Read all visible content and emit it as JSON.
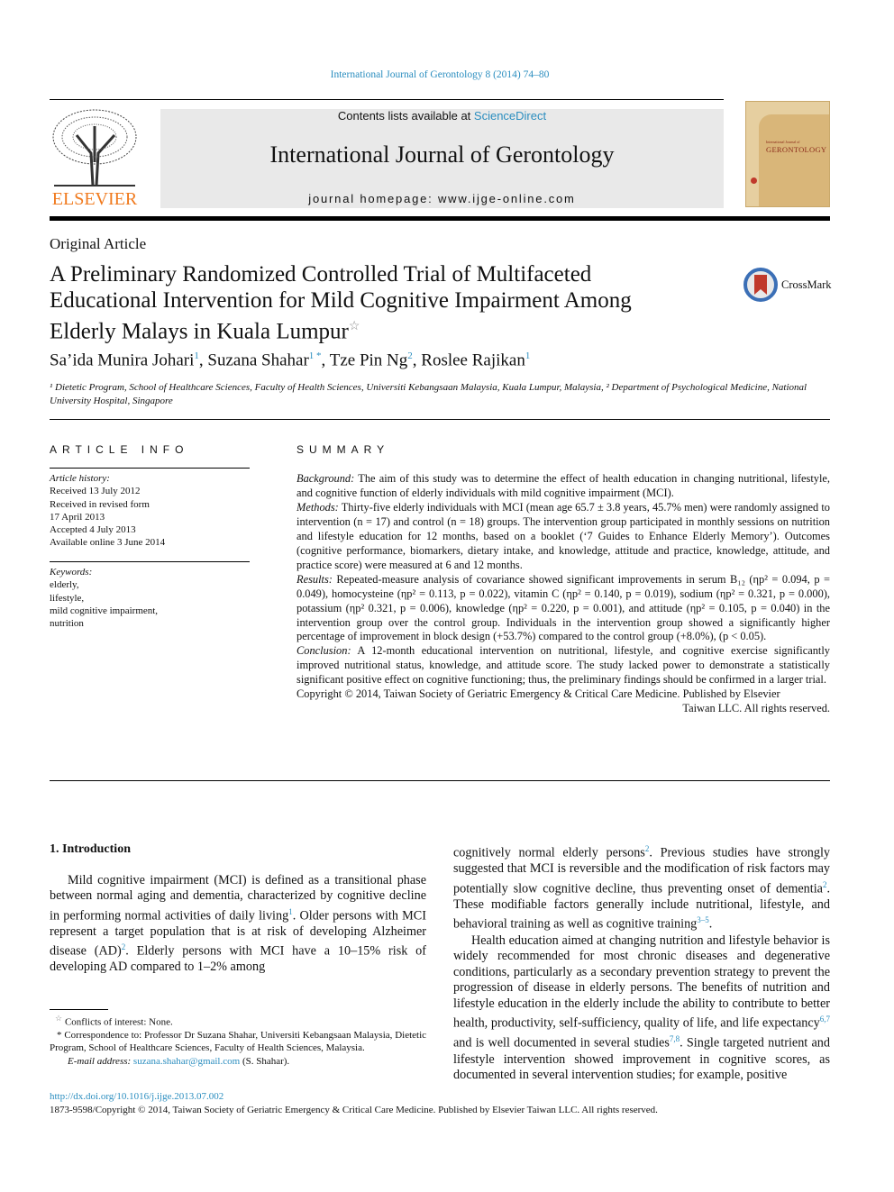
{
  "header": {
    "citation": "International Journal of Gerontology 8 (2014) 74–80",
    "contents_prefix": "Contents lists available at ",
    "contents_link": "ScienceDirect",
    "journal_title": "International Journal of Gerontology",
    "homepage": "journal homepage: www.ijge-online.com",
    "publisher_logo": "ELSEVIER",
    "cover_title_small": "International Journal of",
    "cover_title": "GERONTOLOGY",
    "crossmark_label": "CrossMark",
    "colors": {
      "link": "#2a8dbf",
      "elsevier": "#f07a1e",
      "header_bg": "#e9e9e9"
    }
  },
  "article": {
    "type": "Original Article",
    "title_lines": [
      "A Preliminary Randomized Controlled Trial of Multifaceted",
      "Educational Intervention for Mild Cognitive Impairment Among",
      "Elderly Malays in Kuala Lumpur"
    ],
    "title_mark": "☆",
    "authors": [
      {
        "name": "Sa’ida Munira Johari",
        "sup": "1"
      },
      {
        "name": "Suzana Shahar",
        "sup": "1 *"
      },
      {
        "name": "Tze Pin Ng",
        "sup": "2"
      },
      {
        "name": "Roslee Rajikan",
        "sup": "1"
      }
    ],
    "affiliations": "¹ Dietetic Program, School of Healthcare Sciences, Faculty of Health Sciences, Universiti Kebangsaan Malaysia, Kuala Lumpur, Malaysia, ² Department of Psychological Medicine, National University Hospital, Singapore"
  },
  "article_info": {
    "heading": "ARTICLE INFO",
    "history_label": "Article history:",
    "history": [
      "Received 13 July 2012",
      "Received in revised form",
      "17 April 2013",
      "Accepted 4 July 2013",
      "Available online 3 June 2014"
    ],
    "keywords_label": "Keywords:",
    "keywords": [
      "elderly,",
      "lifestyle,",
      "mild cognitive impairment,",
      "nutrition"
    ]
  },
  "summary": {
    "heading": "SUMMARY",
    "sections": [
      {
        "label": "Background:",
        "text": " The aim of this study was to determine the effect of health education in changing nutritional, lifestyle, and cognitive function of elderly individuals with mild cognitive impairment (MCI)."
      },
      {
        "label": "Methods:",
        "text": " Thirty-five elderly individuals with MCI (mean age 65.7 ± 3.8 years, 45.7% men) were randomly assigned to intervention (n = 17) and control (n = 18) groups. The intervention group participated in monthly sessions on nutrition and lifestyle education for 12 months, based on a booklet (‘7 Guides to Enhance Elderly Memory’). Outcomes (cognitive performance, biomarkers, dietary intake, and knowledge, attitude and practice, knowledge, attitude, and practice score) were measured at 6 and 12 months."
      },
      {
        "label": "Results:",
        "text": " Repeated-measure analysis of covariance showed significant improvements in serum B₁₂ (ηp² = 0.094, p = 0.049), homocysteine (ηp² = 0.113, p = 0.022), vitamin C (ηp² = 0.140, p = 0.019), sodium (ηp² = 0.321, p = 0.000), potassium (ηp² 0.321, p = 0.006), knowledge (ηp² = 0.220, p = 0.001), and attitude (ηp² = 0.105, p = 0.040) in the intervention group over the control group. Individuals in the intervention group showed a significantly higher percentage of improvement in block design (+53.7%) compared to the control group (+8.0%), (p < 0.05)."
      },
      {
        "label": "Conclusion:",
        "text": " A 12-month educational intervention on nutritional, lifestyle, and cognitive exercise significantly improved nutritional status, knowledge, and attitude score. The study lacked power to demonstrate a statistically significant positive effect on cognitive functioning; thus, the preliminary findings should be confirmed in a larger trial."
      }
    ],
    "copyright_1": "Copyright © 2014, Taiwan Society of Geriatric Emergency & Critical Care Medicine. Published by Elsevier",
    "copyright_2": "Taiwan LLC. All rights reserved."
  },
  "body": {
    "intro_heading": "1.  Introduction",
    "left_para": [
      {
        "t": "Mild cognitive impairment (MCI) is defined as a transitional phase between normal aging and dementia, characterized by cognitive decline in performing normal activities of daily living"
      },
      {
        "sup": "1"
      },
      {
        "t": ". Older persons with MCI represent a target population that is at risk of developing Alzheimer disease (AD)"
      },
      {
        "sup": "2"
      },
      {
        "t": ". Elderly persons with MCI have a 10–15% risk of developing AD compared to 1–2% among"
      }
    ],
    "right_para_1": [
      {
        "t": "cognitively normal elderly persons"
      },
      {
        "sup": "2"
      },
      {
        "t": ". Previous studies have strongly suggested that MCI is reversible and the modification of risk factors may potentially slow cognitive decline, thus preventing onset of dementia"
      },
      {
        "sup": "2"
      },
      {
        "t": ". These modifiable factors generally include nutritional, lifestyle, and behavioral training as well as cognitive training"
      },
      {
        "sup": "3–5"
      },
      {
        "t": "."
      }
    ],
    "right_para_2": [
      {
        "t": "Health education aimed at changing nutrition and lifestyle behavior is widely recommended for most chronic diseases and degenerative conditions, particularly as a secondary prevention strategy to prevent the progression of disease in elderly persons. The benefits of nutrition and lifestyle education in the elderly include the ability to contribute to better health, productivity, self-sufficiency, quality of life, and life expectancy"
      },
      {
        "sup": "6,7"
      },
      {
        "t": " and is well documented in several studies"
      },
      {
        "sup": "7,8"
      },
      {
        "t": ". Single targeted nutrient and lifestyle intervention showed improvement in cognitive scores, as documented in several intervention studies; for example, positive"
      }
    ]
  },
  "footnotes": {
    "conflict_mark": "☆",
    "conflict": "Conflicts of interest: None.",
    "corr_mark": "*",
    "correspondence": "Correspondence to: Professor Dr Suzana Shahar, Universiti Kebangsaan Malaysia, Dietetic Program, School of Healthcare Sciences, Faculty of Health Sciences, Malaysia.",
    "email_label": "E-mail address:",
    "email": "suzana.shahar@gmail.com",
    "email_owner": "(S. Shahar)."
  },
  "footer": {
    "doi": "http://dx.doi.org/10.1016/j.ijge.2013.07.002",
    "copyright": "1873-9598/Copyright © 2014, Taiwan Society of Geriatric Emergency & Critical Care Medicine. Published by Elsevier Taiwan LLC. All rights reserved."
  }
}
